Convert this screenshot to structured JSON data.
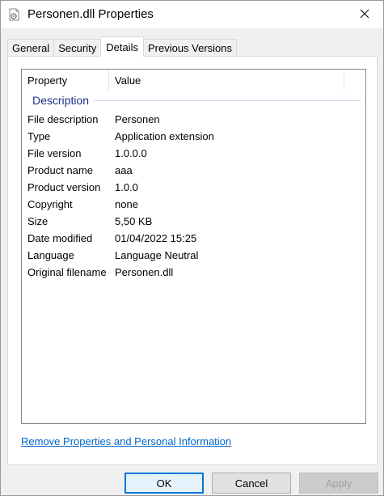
{
  "window": {
    "title": "Personen.dll Properties"
  },
  "icons": {
    "title_icon": "dll-file-icon",
    "close_icon": "close-icon"
  },
  "tabs": [
    {
      "label": "General",
      "active": false
    },
    {
      "label": "Security",
      "active": false
    },
    {
      "label": "Details",
      "active": true
    },
    {
      "label": "Previous Versions",
      "active": false
    }
  ],
  "details": {
    "columns": {
      "property": "Property",
      "value": "Value"
    },
    "group": "Description",
    "rows": [
      {
        "property": "File description",
        "value": "Personen"
      },
      {
        "property": "Type",
        "value": "Application extension"
      },
      {
        "property": "File version",
        "value": "1.0.0.0"
      },
      {
        "property": "Product name",
        "value": "aaa"
      },
      {
        "property": "Product version",
        "value": "1.0.0"
      },
      {
        "property": "Copyright",
        "value": "none"
      },
      {
        "property": "Size",
        "value": "5,50 KB"
      },
      {
        "property": "Date modified",
        "value": "01/04/2022 15:25"
      },
      {
        "property": "Language",
        "value": "Language Neutral"
      },
      {
        "property": "Original filename",
        "value": "Personen.dll"
      }
    ]
  },
  "link": "Remove Properties and Personal Information",
  "buttons": {
    "ok": "OK",
    "cancel": "Cancel",
    "apply": "Apply",
    "apply_enabled": false
  },
  "colors": {
    "accent": "#0078d7",
    "link": "#0066cc",
    "group_header": "#1e3287"
  }
}
